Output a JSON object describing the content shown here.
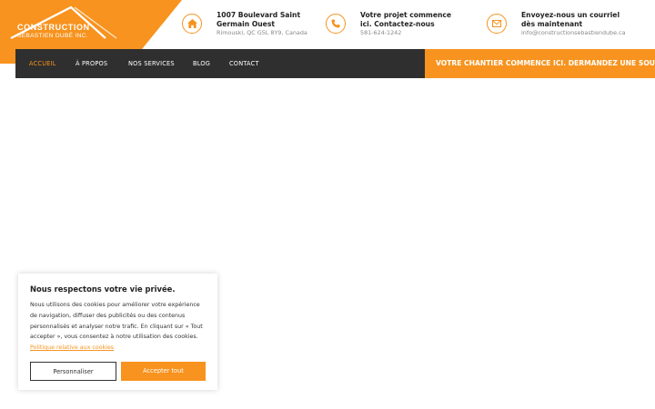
{
  "brand": {
    "name": "CONSTRUCTION",
    "subtitle": "SÉBASTIEN DUBÉ INC."
  },
  "colors": {
    "accent": "#f7931e",
    "nav_bg": "#2f2f2f",
    "text_dark": "#222222",
    "text_muted": "#888888"
  },
  "contacts": [
    {
      "icon": "home-icon",
      "title": "1007 Boulevard Saint Germain Ouest",
      "detail": "Rimouski, QC G5L 8Y9, Canada"
    },
    {
      "icon": "phone-icon",
      "title": "Votre projet commence ici. Contactez-nous",
      "detail": "581-624-1242"
    },
    {
      "icon": "envelope-icon",
      "title": "Envoyez-nous un courriel dès maintenant",
      "detail": "info@constructionsebastiendube.ca"
    }
  ],
  "nav": {
    "items": [
      {
        "label": "ACCUEIL",
        "active": true
      },
      {
        "label": "À PROPOS",
        "active": false
      },
      {
        "label": "NOS SERVICES",
        "active": false
      },
      {
        "label": "BLOG",
        "active": false
      },
      {
        "label": "CONTACT",
        "active": false
      }
    ],
    "cta": "VOTRE CHANTIER COMMENCE ICI. DERMANDEZ UNE SOUMISSION"
  },
  "cookie": {
    "title": "Nous respectons votre vie privée.",
    "body": "Nous utilisons des cookies pour améliorer votre expérience de navigation, diffuser des publicités ou des contenus personnalisés et analyser notre trafic. En cliquant sur « Tout accepter », vous consentez à notre utilisation des cookies.",
    "link": "Politique relative aux cookies",
    "customize_label": "Personnaliser",
    "accept_label": "Accepter tout"
  }
}
